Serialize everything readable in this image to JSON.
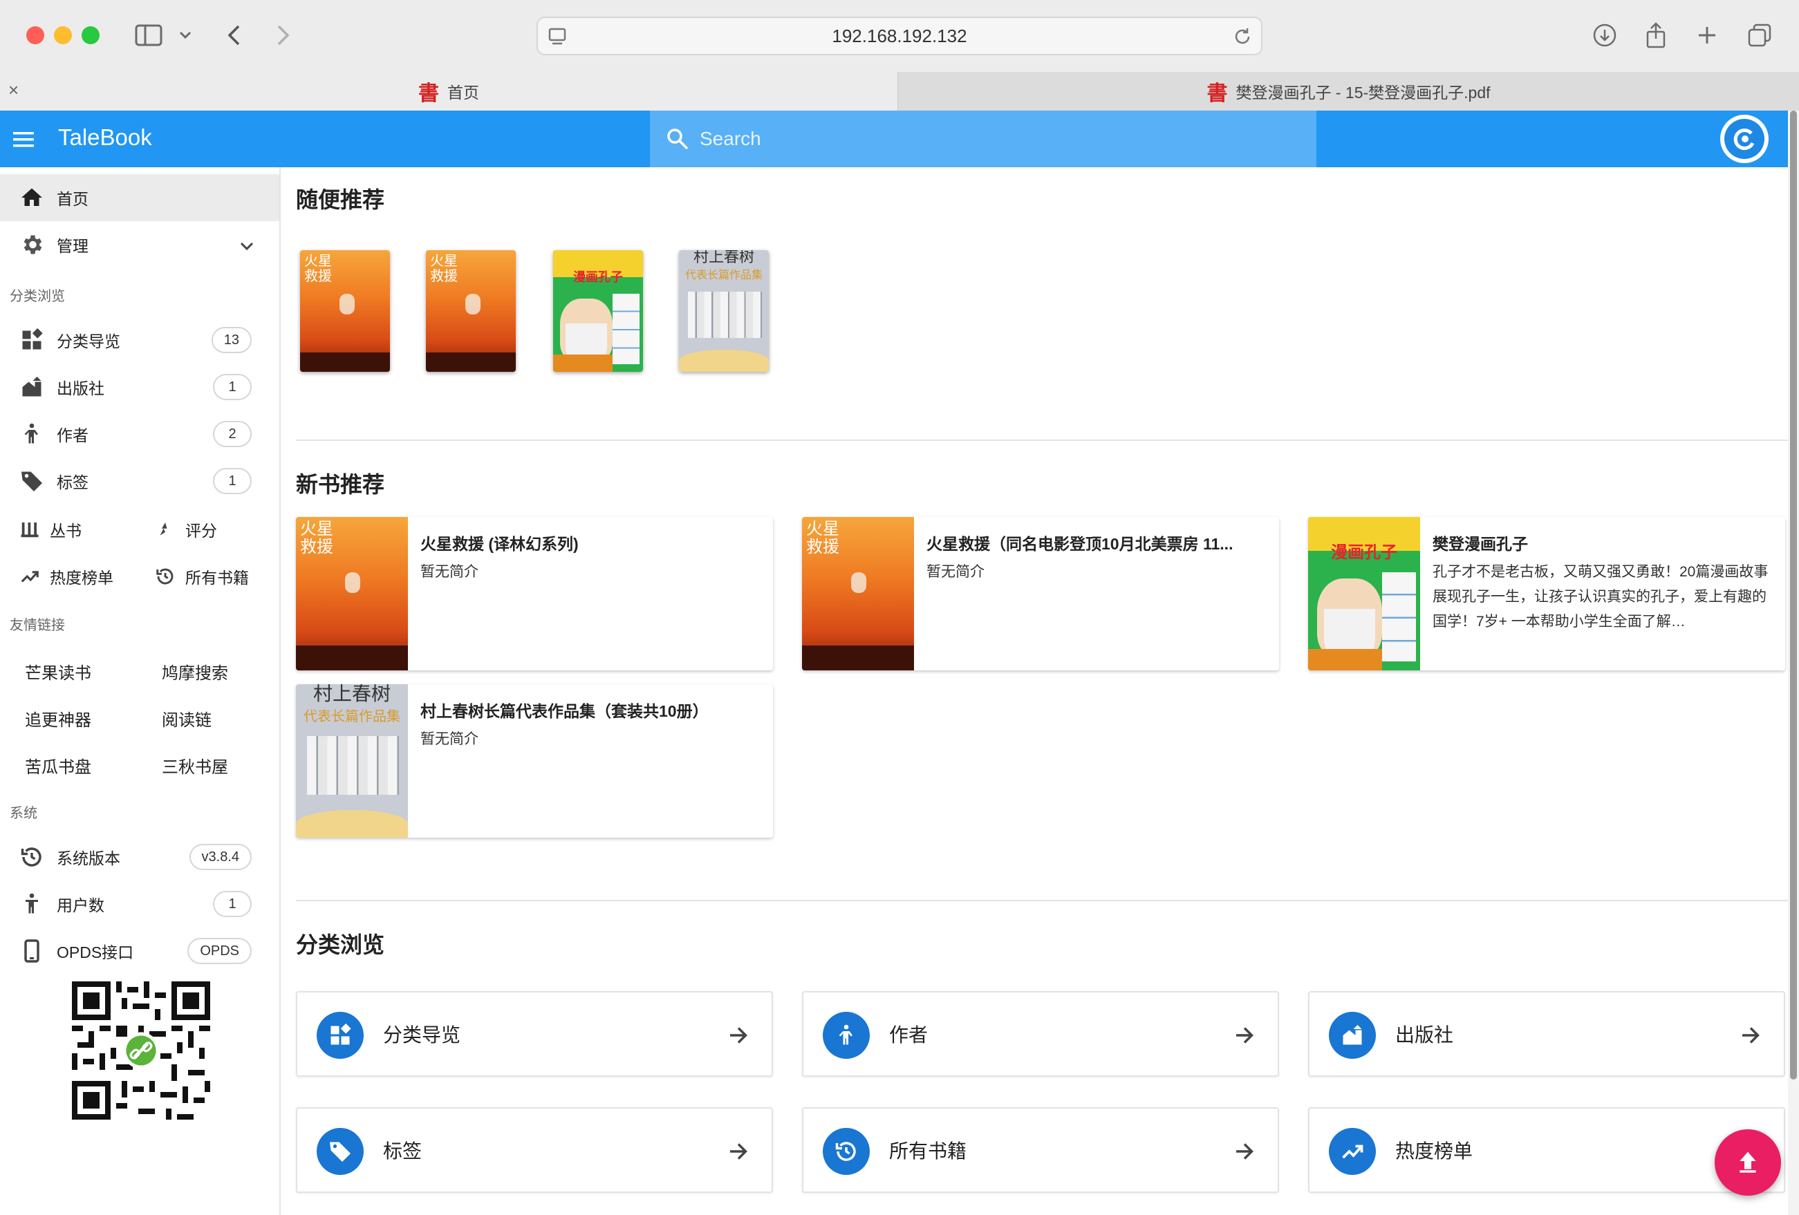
{
  "browser": {
    "url": "192.168.192.132",
    "tabs": [
      {
        "title": "首页",
        "active": true
      },
      {
        "title": "樊登漫画孔子 - 15-樊登漫画孔子.pdf",
        "active": false
      }
    ],
    "favicon_glyph": "書"
  },
  "appbar": {
    "title": "TaleBook",
    "search_placeholder": "Search",
    "brand_color": "#2196f3"
  },
  "sidebar": {
    "home": "首页",
    "admin": "管理",
    "browse_section": "分类浏览",
    "browse_items": [
      {
        "label": "分类导览",
        "count": "13",
        "icon": "category-icon"
      },
      {
        "label": "出版社",
        "count": "1",
        "icon": "publisher-icon"
      },
      {
        "label": "作者",
        "count": "2",
        "icon": "author-icon"
      },
      {
        "label": "标签",
        "count": "1",
        "icon": "tag-icon"
      }
    ],
    "half_items": [
      {
        "label": "丛书",
        "icon": "series-icon"
      },
      {
        "label": "评分",
        "icon": "rating-icon"
      },
      {
        "label": "热度榜单",
        "icon": "trending-icon"
      },
      {
        "label": "所有书籍",
        "icon": "history-icon"
      }
    ],
    "links_section": "友情链接",
    "links": [
      "芒果读书",
      "鸠摩搜索",
      "追更神器",
      "阅读链",
      "苦瓜书盘",
      "三秋书屋"
    ],
    "system_section": "系统",
    "system_items": [
      {
        "label": "系统版本",
        "value": "v3.8.4",
        "icon": "history-icon"
      },
      {
        "label": "用户数",
        "value": "1",
        "icon": "user-icon"
      },
      {
        "label": "OPDS接口",
        "value": "OPDS",
        "icon": "phone-icon"
      }
    ]
  },
  "main": {
    "random_title": "随便推荐",
    "random_books": [
      {
        "cover": "mars",
        "cover_text": "火星\n救援"
      },
      {
        "cover": "mars",
        "cover_text": "火星\n救援"
      },
      {
        "cover": "kongzi",
        "cover_text": "漫画孔子"
      },
      {
        "cover": "murakami",
        "cover_text": "村上春树",
        "cover_sub": "代表长篇作品集"
      }
    ],
    "new_title": "新书推荐",
    "new_books": [
      {
        "title": "火星救援 (译林幻系列)",
        "desc": "暂无简介",
        "cover": "mars",
        "cover_text": "火星\n救援"
      },
      {
        "title": "火星救援（同名电影登顶10月北美票房 11...",
        "desc": "暂无简介",
        "cover": "mars",
        "cover_text": "火星\n救援"
      },
      {
        "title": "樊登漫画孔子",
        "desc": "孔子才不是老古板，又萌又强又勇敢！20篇漫画故事展现孔子一生，让孩子认识真实的孔子，爱上有趣的国学！7岁+ 一本帮助小学生全面了解…",
        "cover": "kongzi",
        "cover_text": "漫画孔子"
      },
      {
        "title": "村上春树长篇代表作品集（套装共10册）",
        "desc": "暂无简介",
        "cover": "murakami",
        "cover_text": "村上春树",
        "cover_sub": "代表长篇作品集"
      }
    ],
    "category_title": "分类浏览",
    "categories": [
      {
        "label": "分类导览",
        "icon": "category-icon"
      },
      {
        "label": "作者",
        "icon": "author-icon"
      },
      {
        "label": "出版社",
        "icon": "publisher-icon"
      },
      {
        "label": "标签",
        "icon": "tag-icon"
      },
      {
        "label": "所有书籍",
        "icon": "history-icon"
      },
      {
        "label": "热度榜单",
        "icon": "trending-icon"
      }
    ],
    "fab_icon": "upload-icon",
    "fab_color": "#e91e63"
  }
}
